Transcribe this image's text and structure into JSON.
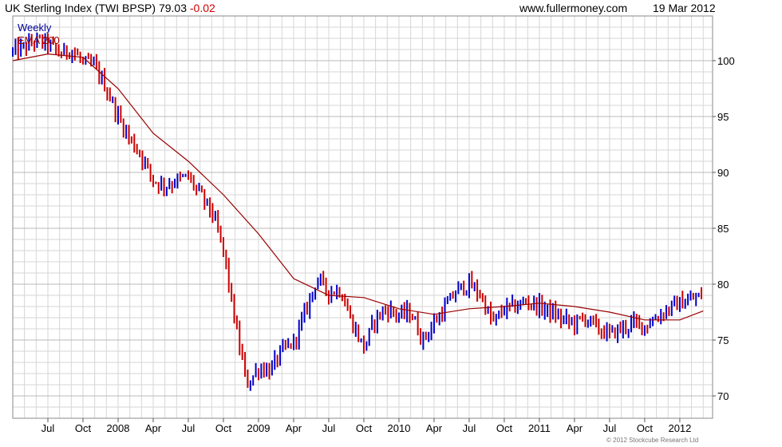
{
  "header": {
    "title": "UK Sterling Index (TWI BPSP)",
    "last_value": "79.03",
    "change": "-0.02",
    "site": "www.fullermoney.com",
    "date": "19 Mar 2012"
  },
  "legend": {
    "period": "Weekly",
    "ema_label": "EMA 200"
  },
  "footer": {
    "copyright": "© 2012 Stockcube Research Ltd"
  },
  "colors": {
    "up_bar": "#0000cc",
    "down_bar": "#cc0000",
    "ema_line": "#990000",
    "grid": "#d6d6d6",
    "change_text": "#cc0000",
    "period_text": "#000099",
    "ema_text": "#990000"
  },
  "chart_data": {
    "type": "line",
    "title": "UK Sterling Index (TWI BPSP)",
    "frequency": "Weekly",
    "x_tick_labels": [
      "Jul",
      "Oct",
      "2008",
      "Apr",
      "Jul",
      "Oct",
      "2009",
      "Apr",
      "Jul",
      "Oct",
      "2010",
      "Apr",
      "Jul",
      "Oct",
      "2011",
      "Apr",
      "Jul",
      "Oct",
      "2012"
    ],
    "y_ticks": [
      70,
      75,
      80,
      85,
      90,
      95,
      100
    ],
    "y_axis_position": "right",
    "ylim": [
      68,
      104
    ],
    "grid": true,
    "legend_position": "top-left",
    "series": [
      {
        "name": "UK Sterling Index (TWI BPSP)",
        "style": "weekly-ohlc",
        "x": [
          "2007-04",
          "2007-05",
          "2007-06",
          "2007-07",
          "2007-08",
          "2007-09",
          "2007-10",
          "2007-11",
          "2007-12",
          "2008-01",
          "2008-02",
          "2008-03",
          "2008-04",
          "2008-05",
          "2008-06",
          "2008-07",
          "2008-08",
          "2008-09",
          "2008-10",
          "2008-11",
          "2008-12",
          "2009-01",
          "2009-02",
          "2009-03",
          "2009-04",
          "2009-05",
          "2009-06",
          "2009-07",
          "2009-08",
          "2009-09",
          "2009-10",
          "2009-11",
          "2009-12",
          "2010-01",
          "2010-02",
          "2010-03",
          "2010-04",
          "2010-05",
          "2010-06",
          "2010-07",
          "2010-08",
          "2010-09",
          "2010-10",
          "2010-11",
          "2010-12",
          "2011-01",
          "2011-02",
          "2011-03",
          "2011-04",
          "2011-05",
          "2011-06",
          "2011-07",
          "2011-08",
          "2011-09",
          "2011-10",
          "2011-11",
          "2011-12",
          "2012-01",
          "2012-02",
          "2012-03"
        ],
        "values": [
          100.8,
          101.2,
          101.8,
          101.5,
          100.6,
          101.0,
          99.8,
          99.5,
          97.5,
          95.0,
          93.0,
          91.5,
          89.3,
          88.8,
          89.3,
          89.6,
          88.0,
          86.5,
          83.0,
          76.5,
          71.0,
          72.5,
          72.3,
          74.0,
          74.8,
          77.5,
          80.5,
          79.3,
          79.5,
          76.5,
          74.3,
          77.0,
          77.8,
          77.2,
          77.5,
          75.0,
          76.5,
          78.0,
          79.5,
          80.0,
          79.0,
          76.5,
          77.8,
          78.0,
          78.5,
          78.0,
          77.5,
          76.8,
          76.5,
          77.0,
          76.0,
          75.5,
          76.0,
          76.5,
          76.3,
          77.0,
          77.8,
          78.3,
          78.6,
          79.03
        ]
      },
      {
        "name": "EMA 200",
        "style": "line",
        "x": [
          "2007-04",
          "2007-07",
          "2007-10",
          "2008-01",
          "2008-04",
          "2008-07",
          "2008-10",
          "2009-01",
          "2009-04",
          "2009-07",
          "2009-10",
          "2010-01",
          "2010-04",
          "2010-07",
          "2010-10",
          "2011-01",
          "2011-04",
          "2011-07",
          "2011-10",
          "2012-01",
          "2012-03"
        ],
        "values": [
          100.0,
          100.6,
          100.3,
          97.5,
          93.5,
          91.0,
          88.0,
          84.5,
          80.5,
          79.0,
          78.8,
          77.8,
          77.3,
          77.8,
          78.0,
          78.3,
          78.0,
          77.5,
          76.8,
          76.8,
          77.6
        ]
      }
    ]
  }
}
